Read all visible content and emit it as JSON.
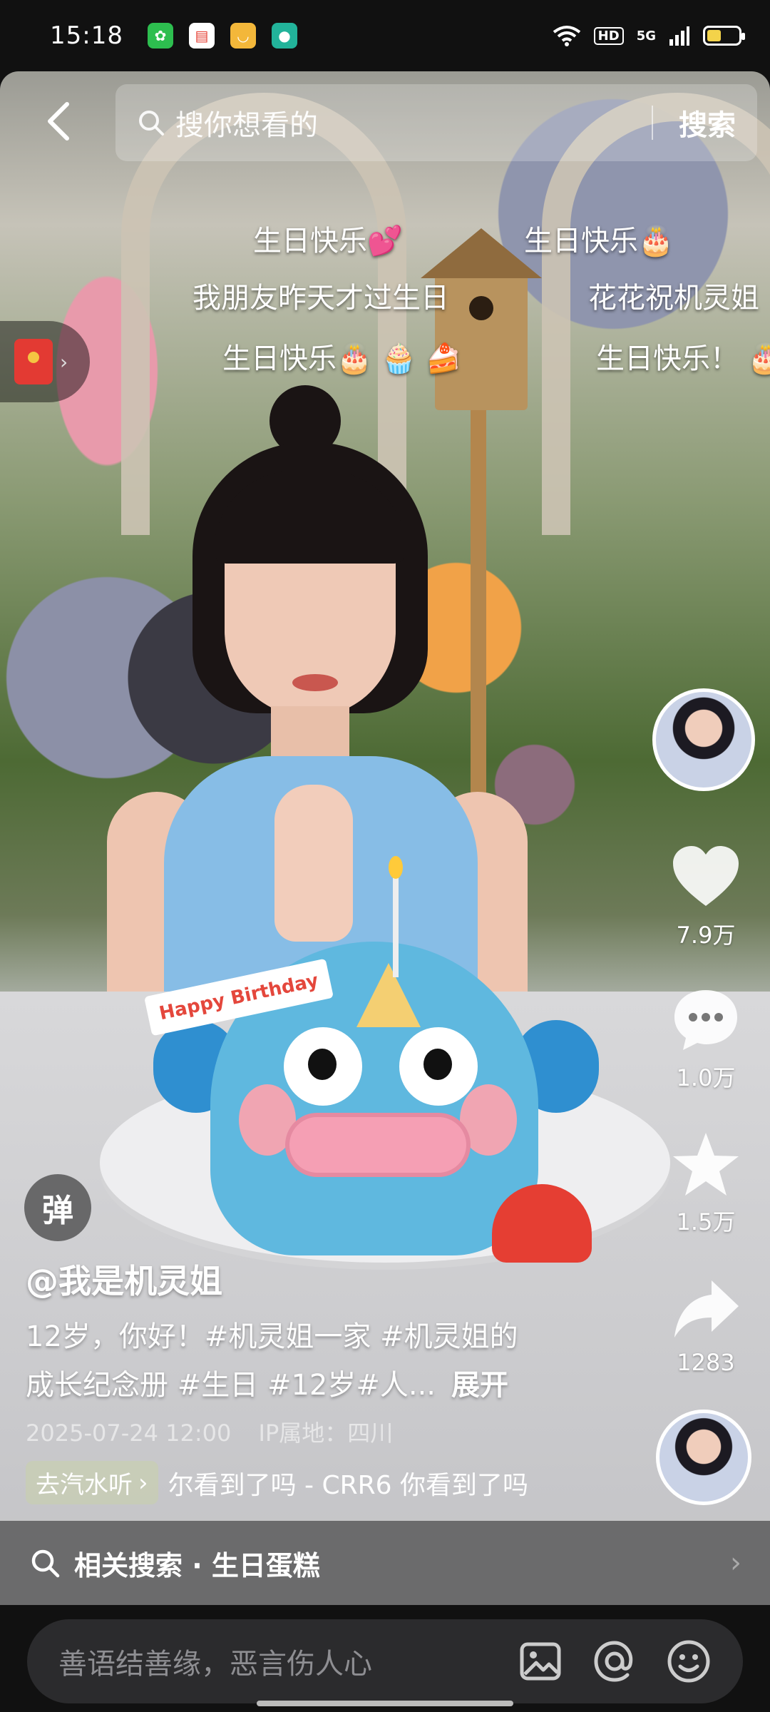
{
  "status_bar": {
    "time": "15:18",
    "apps": [
      {
        "icon": "green-app-icon",
        "color": "#2dbe4f"
      },
      {
        "icon": "wallet-app-icon",
        "color": "#ffffff"
      },
      {
        "icon": "coupon-app-icon",
        "color": "#f3b73a"
      },
      {
        "icon": "chat-app-icon",
        "color": "#22b39a"
      }
    ],
    "network": "5G",
    "hd": "HD",
    "battery_level": 0.45
  },
  "top_bar": {
    "search_placeholder": "搜你想看的",
    "search_button": "搜索"
  },
  "danmaku": [
    "生日快乐💕",
    "生日快乐🎂",
    "我朋友昨天才过生日",
    "花花祝机灵姐",
    "生日快乐🎂 🧁 🍰",
    "生日快乐！ 🎂"
  ],
  "video": {
    "flag_text": "Happy Birthday"
  },
  "right_rail": {
    "likes": "7.9万",
    "comments": "1.0万",
    "favorites": "1.5万",
    "shares": "1283"
  },
  "info": {
    "danmu_toggle": "弹",
    "author": "@我是机灵姐",
    "description_line1": "12岁，你好！#机灵姐一家 #机灵姐的",
    "description_line2": "成长纪念册 #生日 #12岁#人...",
    "expand": "展开",
    "date": "2025-07-24 12:00",
    "ip_location": "IP属地：四川",
    "music_chip": "去汽水听",
    "music_title": "尔看到了吗 - CRR6    你看到了吗"
  },
  "related_search": {
    "label": "相关搜索 · 生日蛋糕"
  },
  "comment_bar": {
    "placeholder": "善语结善缘，恶言伤人心"
  },
  "colors": {
    "accent_red": "#e33a33",
    "battery_yellow": "#f3d34a"
  }
}
